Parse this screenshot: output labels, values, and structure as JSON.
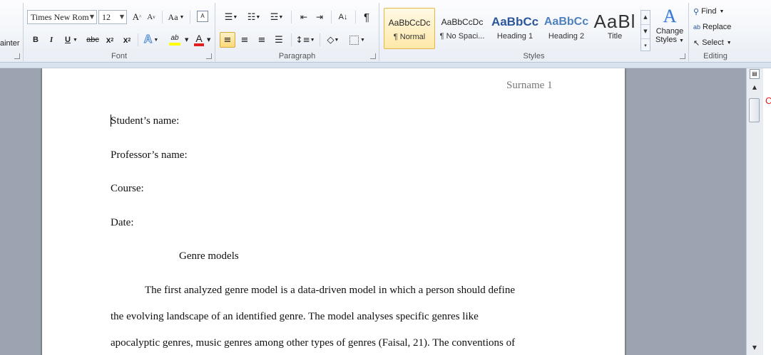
{
  "ribbon": {
    "clipboard": {
      "format_painter_label": "ainter"
    },
    "font": {
      "group_label": "Font",
      "font_name": "Times New Rom",
      "font_size": "12",
      "grow": "A",
      "shrink": "A",
      "change_case": "Aa",
      "clear_format": "A",
      "bold": "B",
      "italic": "I",
      "underline": "U",
      "strikethrough": "abc",
      "subscript": "x",
      "superscript": "x",
      "text_effects": "A",
      "highlight": "ab",
      "font_color": "A"
    },
    "paragraph": {
      "group_label": "Paragraph",
      "pilcrow": "¶",
      "sort": "A↓"
    },
    "styles": {
      "group_label": "Styles",
      "items": [
        {
          "preview": "AaBbCcDc",
          "name": "¶ Normal",
          "selected": true
        },
        {
          "preview": "AaBbCcDc",
          "name": "¶ No Spaci...",
          "selected": false
        },
        {
          "preview": "AaBbCc",
          "name": "Heading 1",
          "selected": false
        },
        {
          "preview": "AaBbCc",
          "name": "Heading 2",
          "selected": false
        },
        {
          "preview": "AaBl",
          "name": "Title",
          "selected": false
        }
      ],
      "change_styles_line1": "Change",
      "change_styles_line2": "Styles"
    },
    "editing": {
      "group_label": "Editing",
      "find": "Find",
      "replace": "Replace",
      "select": "Select"
    }
  },
  "document": {
    "header": "Surname 1",
    "lines": [
      "Student’s name:",
      "Professor’s name:",
      "Course:",
      "Date:",
      "Genre models",
      "The first analyzed genre model is a data-driven model in which a person should define",
      "the evolving landscape of an identified genre. The model analyses specific genres like",
      "apocalyptic genres, music genres among other types of genres (Faisal, 21). The conventions of"
    ]
  },
  "colors": {
    "accent_selected_style": "#e3b64a",
    "heading_blue": "#2b579a",
    "highlight_yellow": "#ffff00",
    "font_color_red": "#e02020"
  }
}
